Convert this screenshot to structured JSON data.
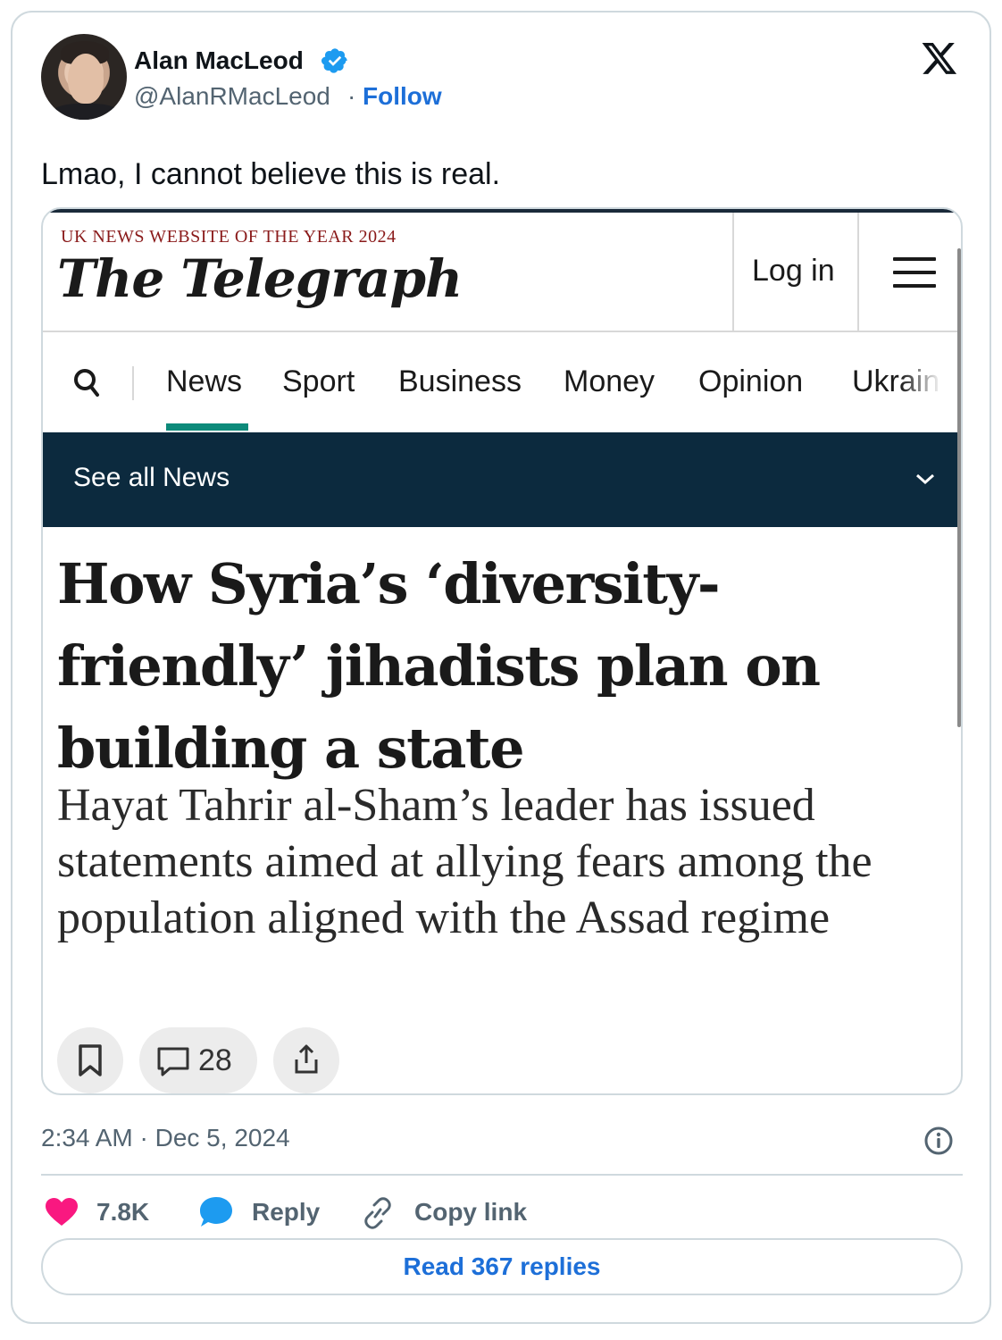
{
  "author": {
    "name": "Alan MacLeod",
    "handle": "@AlanRMacLeod",
    "separator": "·",
    "follow_label": "Follow"
  },
  "tweet": {
    "text": "Lmao, I cannot believe this is real.",
    "timestamp": "2:34 AM · Dec 5, 2024"
  },
  "embed": {
    "award": "UK NEWS WEBSITE OF THE YEAR 2024",
    "logo": "The Telegraph",
    "login_label": "Log in",
    "nav_items": [
      "News",
      "Sport",
      "Business",
      "Money",
      "Opinion",
      "Ukrain"
    ],
    "active_nav": "News",
    "subbar_label": "See all News",
    "headline": "How Syria’s ‘diversity-friendly’ jihadists plan on building a state",
    "standfirst": "Hayat Tahrir al-Sham’s leader has issued statements aimed at allying fears among the population aligned with the Assad regime",
    "comment_count": "28"
  },
  "engagement": {
    "likes": "7.8K",
    "reply_label": "Reply",
    "copy_link_label": "Copy link",
    "read_replies_label": "Read 367 replies"
  },
  "colors": {
    "accent_blue": "#1d6fd8",
    "like_pink": "#f91880",
    "telegraph_navy": "#0c2a3e",
    "telegraph_teal": "#0d8a7a",
    "award_red": "#8a1a1a"
  },
  "icons": [
    "verified-icon",
    "x-logo-icon",
    "menu-icon",
    "search-icon",
    "chevron-down-icon",
    "bookmark-icon",
    "comment-icon",
    "share-icon",
    "info-icon",
    "heart-icon",
    "reply-bubble-icon",
    "link-icon"
  ]
}
